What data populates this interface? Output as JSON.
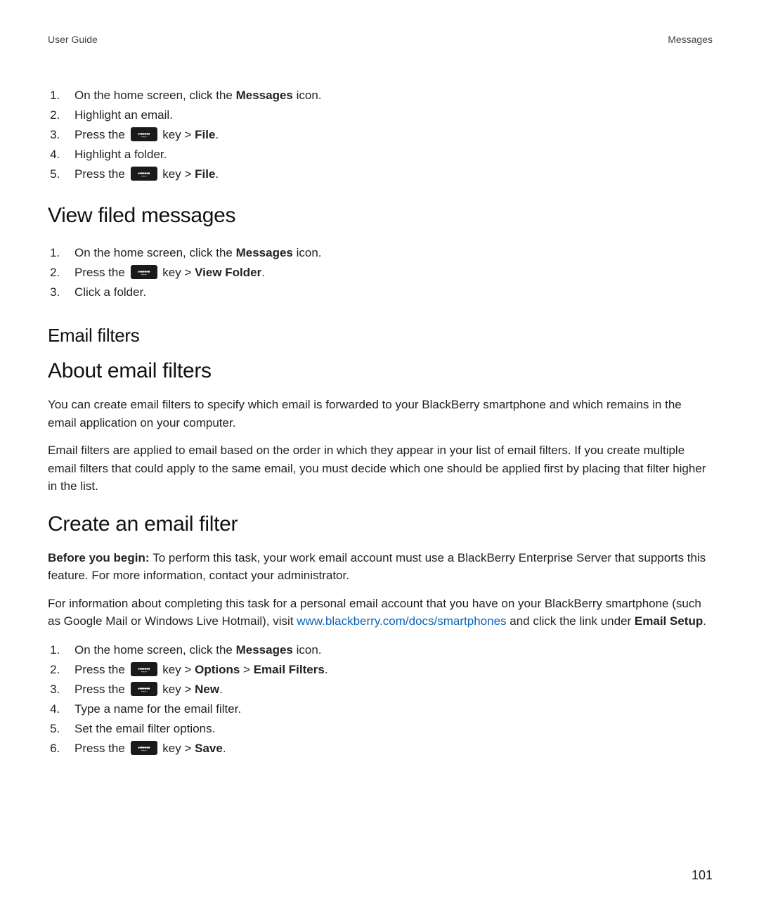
{
  "header": {
    "left": "User Guide",
    "right": "Messages"
  },
  "list1": {
    "item1_pre": "On the home screen, click the ",
    "item1_bold": "Messages",
    "item1_post": " icon.",
    "item2": "Highlight an email.",
    "item3_pre": "Press the ",
    "item3_mid": " key > ",
    "item3_bold": "File",
    "item3_post": ".",
    "item4": "Highlight a folder.",
    "item5_pre": "Press the ",
    "item5_mid": " key > ",
    "item5_bold": "File",
    "item5_post": "."
  },
  "section_view_filed": {
    "heading": "View filed messages",
    "item1_pre": "On the home screen, click the ",
    "item1_bold": "Messages",
    "item1_post": " icon.",
    "item2_pre": "Press the ",
    "item2_mid": " key > ",
    "item2_bold": "View Folder",
    "item2_post": ".",
    "item3": "Click a folder."
  },
  "email_filters": {
    "heading": "Email filters",
    "about_heading": "About email filters",
    "about_p1": "You can create email filters to specify which email is forwarded to your BlackBerry smartphone and which remains in the email application on your computer.",
    "about_p2": "Email filters are applied to email based on the order in which they appear in your list of email filters. If you create multiple email filters that could apply to the same email, you must decide which one should be applied first by placing that filter higher in the list.",
    "create_heading": "Create an email filter",
    "create_before_bold": "Before you begin: ",
    "create_before_text": "To perform this task, your work email account must use a BlackBerry Enterprise Server that supports this feature. For more information, contact your administrator.",
    "create_p2_pre": "For information about completing this task for a personal email account that you have on your BlackBerry smartphone (such as Google Mail or Windows Live Hotmail), visit ",
    "create_p2_link": "www.blackberry.com/docs/smartphones",
    "create_p2_mid": " and click the link under ",
    "create_p2_bold": "Email Setup",
    "create_p2_post": ".",
    "create_list": {
      "item1_pre": "On the home screen, click the ",
      "item1_bold": "Messages",
      "item1_post": " icon.",
      "item2_pre": "Press the ",
      "item2_mid": " key > ",
      "item2_bold1": "Options",
      "item2_sep": " > ",
      "item2_bold2": "Email Filters",
      "item2_post": ".",
      "item3_pre": "Press the ",
      "item3_mid": " key > ",
      "item3_bold": "New",
      "item3_post": ".",
      "item4": "Type a name for the email filter.",
      "item5": "Set the email filter options.",
      "item6_pre": "Press the ",
      "item6_mid": " key > ",
      "item6_bold": "Save",
      "item6_post": "."
    }
  },
  "page_number": "101"
}
